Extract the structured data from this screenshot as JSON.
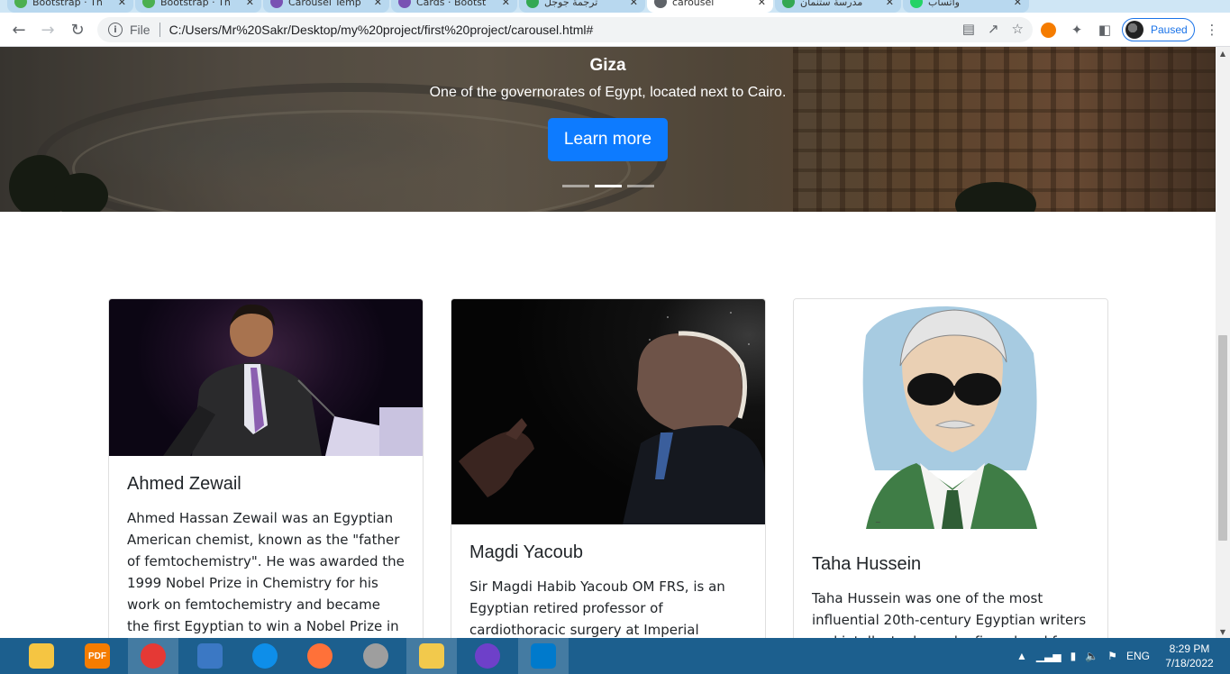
{
  "browser": {
    "tabs": [
      {
        "label": "Bootstrap · Th",
        "favicon_color": "#4caf50"
      },
      {
        "label": "Bootstrap · Th",
        "favicon_color": "#4caf50"
      },
      {
        "label": "Carousel Temp",
        "favicon_color": "#7952b3"
      },
      {
        "label": "Cards · Bootst",
        "favicon_color": "#7952b3"
      },
      {
        "label": "ترجمة جوجل",
        "favicon_color": "#34a853"
      },
      {
        "label": "carousel",
        "favicon_color": "#5f6368",
        "active": true
      },
      {
        "label": "مدرسة ستنمان",
        "favicon_color": "#34a853"
      },
      {
        "label": "واتساب",
        "favicon_color": "#25d366"
      }
    ],
    "scheme": "File",
    "url": "C:/Users/Mr%20Sakr/Desktop/my%20project/first%20project/carousel.html#",
    "profile_status": "Paused"
  },
  "carousel": {
    "title": "Giza",
    "text": "One of the governorates of Egypt, located next to Cairo.",
    "button_label": "Learn more",
    "indicator_count": 3,
    "active_indicator": 1
  },
  "cards": [
    {
      "title": "Ahmed Zewail",
      "text": "Ahmed Hassan Zewail was an Egyptian American chemist, known as the \"father of femtochemistry\". He was awarded the 1999 Nobel Prize in Chemistry for his work on femtochemistry and became the first Egyptian to win a Nobel Prize in a scientific"
    },
    {
      "title": "Magdi Yacoub",
      "text": "Sir Magdi Habib Yacoub OM FRS, is an Egyptian retired professor of cardiothoracic surgery at Imperial College London, best"
    },
    {
      "title": "Taha Hussein",
      "text": "Taha Hussein was one of the most influential 20th-century Egyptian writers and intellectuals, and a figurehead for the"
    }
  ],
  "taskbar": {
    "apps": [
      {
        "name": "tools-icon",
        "color": "#f5c542",
        "open": false
      },
      {
        "name": "pdf-icon",
        "label": "PDF",
        "color": "#f57c00",
        "open": false
      },
      {
        "name": "chrome-icon",
        "color": "#e53935",
        "open": true
      },
      {
        "name": "computer-icon",
        "color": "#3b78c4",
        "open": false
      },
      {
        "name": "teamviewer-icon",
        "color": "#0e8ee9",
        "open": false
      },
      {
        "name": "firefox-icon",
        "color": "#ff7139",
        "open": false
      },
      {
        "name": "media-player-icon",
        "color": "#9e9e9e",
        "open": false
      },
      {
        "name": "file-explorer-icon",
        "color": "#f2c94c",
        "open": true
      },
      {
        "name": "github-icon",
        "color": "#6e40c9",
        "open": false
      },
      {
        "name": "vscode-icon",
        "color": "#007acc",
        "open": true
      }
    ],
    "language": "ENG",
    "time": "8:29 PM",
    "date": "7/18/2022"
  }
}
